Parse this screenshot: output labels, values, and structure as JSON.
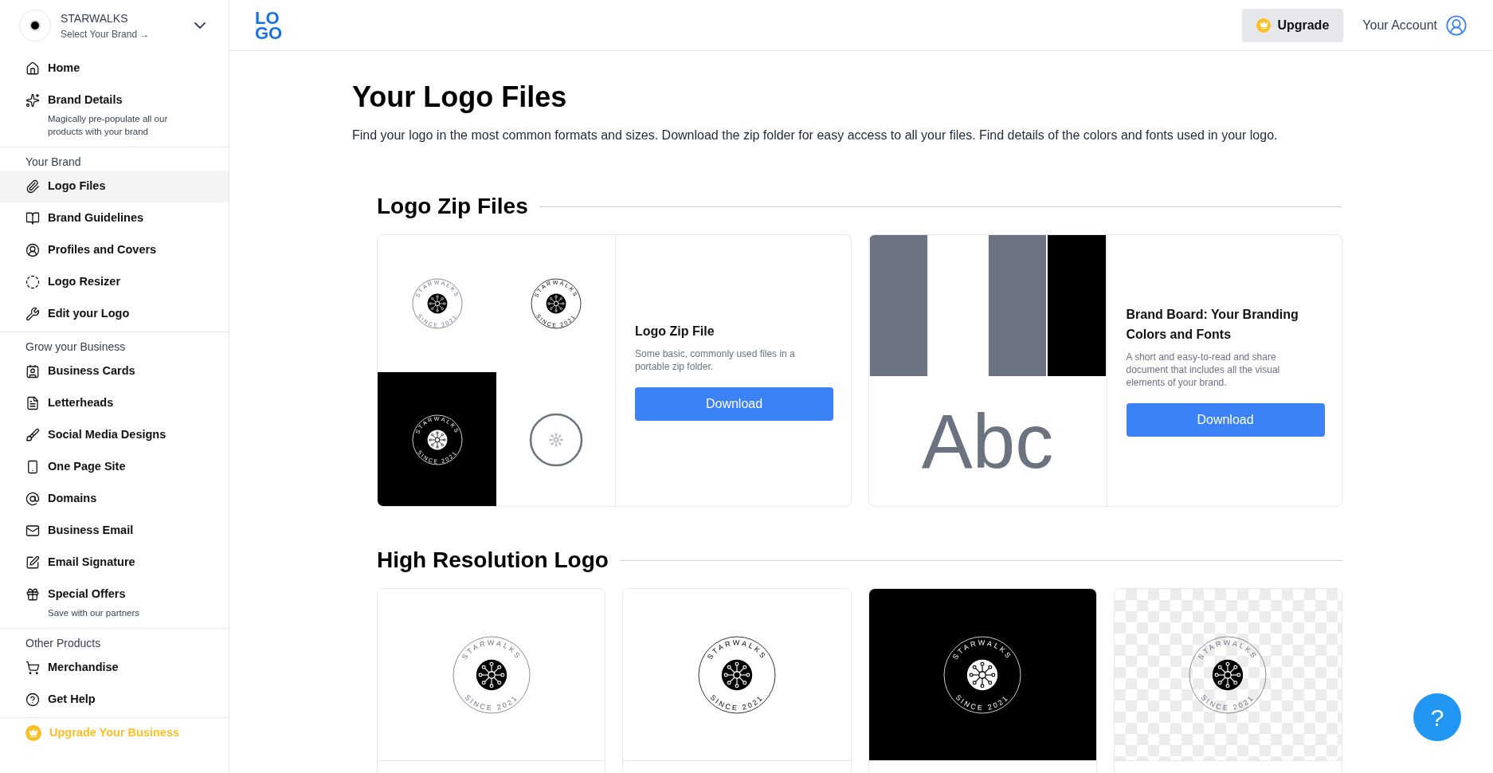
{
  "brand": {
    "name": "STARWALKS",
    "subtitle": "Select Your Brand →"
  },
  "sidebar": {
    "sections": [
      {
        "items": [
          {
            "label": "Home",
            "selected": false
          },
          {
            "label": "Brand Details",
            "subtitle": "Magically pre-populate all our products with your brand",
            "selected": false
          }
        ]
      },
      {
        "heading": "Your Brand",
        "items": [
          {
            "label": "Logo Files",
            "selected": true
          },
          {
            "label": "Brand Guidelines",
            "selected": false
          },
          {
            "label": "Profiles and Covers",
            "selected": false
          },
          {
            "label": "Logo Resizer",
            "selected": false
          },
          {
            "label": "Edit your Logo",
            "selected": false
          }
        ]
      },
      {
        "heading": "Grow your Business",
        "items": [
          {
            "label": "Business Cards",
            "selected": false
          },
          {
            "label": "Letterheads",
            "selected": false
          },
          {
            "label": "Social Media Designs",
            "selected": false
          },
          {
            "label": "One Page Site",
            "selected": false
          },
          {
            "label": "Domains",
            "selected": false
          },
          {
            "label": "Business Email",
            "selected": false
          },
          {
            "label": "Email Signature",
            "selected": false
          },
          {
            "label": "Special Offers",
            "subtitle": "Save with our partners",
            "selected": false
          }
        ]
      },
      {
        "heading": "Other Products",
        "items": [
          {
            "label": "Merchandise",
            "selected": false
          },
          {
            "label": "Get Help",
            "selected": false
          }
        ]
      }
    ],
    "upgrade": "Upgrade Your Business"
  },
  "header": {
    "logo_lines": [
      "LO",
      "GO"
    ],
    "upgrade_button": "Upgrade",
    "account": "Your Account"
  },
  "page": {
    "title": "Your Logo Files",
    "description": "Find your logo in the most common formats and sizes. Download the zip folder for easy access to all your files. Find details of the colors and fonts used in your logo."
  },
  "zip_section": {
    "heading": "Logo Zip Files",
    "cards": [
      {
        "kind": "zip",
        "title": "Logo Zip File",
        "description": "Some basic, commonly used files in a portable zip folder.",
        "button": "Download",
        "previews": [
          {
            "kind": "logo",
            "ring_top": "STARWALKS",
            "ring_bottom": "SINCE 2021"
          },
          {
            "kind": "logo",
            "ring_top": "STARWALKS",
            "ring_bottom": "SINCE 2021"
          },
          {
            "kind": "logo",
            "ring_top": "STARWALKS",
            "ring_bottom": "SINCE 2021"
          },
          {
            "kind": "icon"
          }
        ]
      },
      {
        "kind": "board",
        "title": "Brand Board: Your Branding Colors and Fonts",
        "description": "A short and easy-to-read and share document that includes all the visual elements of your brand.",
        "button": "Download",
        "swatches": [
          {
            "color": "#6b7280"
          },
          {
            "color": "#ffffff"
          },
          {
            "color": "#6b7280"
          },
          {
            "color": "#000000"
          }
        ],
        "font_sample": "Abc"
      }
    ]
  },
  "high_res_section": {
    "heading": "High Resolution Logo",
    "logos": [
      {
        "ring_top": "STARWALKS",
        "ring_bottom": "SINCE 2021"
      },
      {
        "ring_top": "STARWALKS",
        "ring_bottom": "SINCE 2021"
      },
      {
        "ring_top": "STARWALKS",
        "ring_bottom": "SINCE 2021"
      },
      {
        "ring_top": "STARWALKS",
        "ring_bottom": "SINCE 2021"
      }
    ]
  },
  "help_button": "?"
}
